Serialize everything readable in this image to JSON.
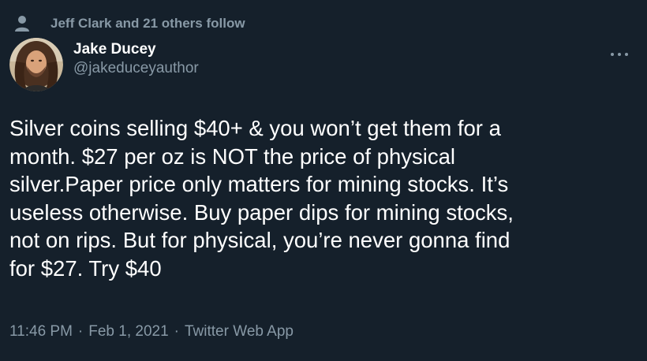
{
  "social_context": {
    "icon": "person-icon",
    "text": "Jeff Clark and 21 others follow"
  },
  "author": {
    "display_name": "Jake Ducey",
    "handle": "@jakeduceyauthor",
    "avatar": "avatar"
  },
  "more_icon": "more-horizontal-icon",
  "tweet": {
    "text": "Silver coins selling $40+ & you won’t get them for a\nmonth. $27 per oz is NOT the price of physical\nsilver.Paper price only matters for mining stocks. It’s\nuseless otherwise. Buy paper dips for mining stocks,\nnot on rips. But for physical, you’re never gonna find\nfor $27. Try $40"
  },
  "meta": {
    "time": "11:46 PM",
    "separator": "·",
    "date": "Feb 1, 2021",
    "source": "Twitter Web App"
  },
  "colors": {
    "background": "#15202b",
    "secondary_text": "#8899a6",
    "primary_text": "#ffffff"
  }
}
